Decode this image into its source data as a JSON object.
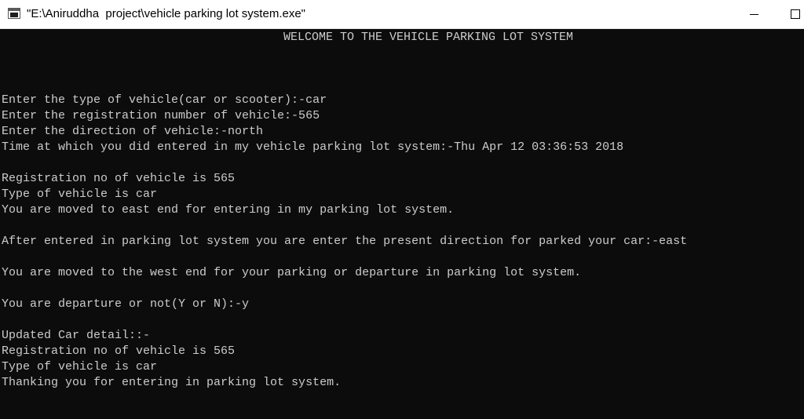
{
  "window": {
    "title": "\"E:\\Aniruddha  project\\vehicle parking lot system.exe\""
  },
  "console": {
    "heading": "WELCOME TO THE VEHICLE PARKING LOT SYSTEM",
    "lines": [
      "Enter the type of vehicle(car or scooter):-car",
      "Enter the registration number of vehicle:-565",
      "Enter the direction of vehicle:-north",
      "Time at which you did entered in my vehicle parking lot system:-Thu Apr 12 03:36:53 2018",
      "Registration no of vehicle is 565",
      "Type of vehicle is car",
      "You are moved to east end for entering in my parking lot system.",
      "After entered in parking lot system you are enter the present direction for parked your car:-east",
      "You are moved to the west end for your parking or departure in parking lot system.",
      "You are departure or not(Y or N):-y",
      "Updated Car detail::-",
      "Registration no of vehicle is 565",
      "Type of vehicle is car",
      "Thanking you for entering in parking lot system."
    ]
  },
  "colors": {
    "console_background": "#0c0c0c",
    "console_text": "#cccccc",
    "titlebar": "#ffffff"
  },
  "icons": {
    "app": "console-app-icon",
    "minimize": "minimize-icon",
    "maximize": "maximize-icon"
  }
}
